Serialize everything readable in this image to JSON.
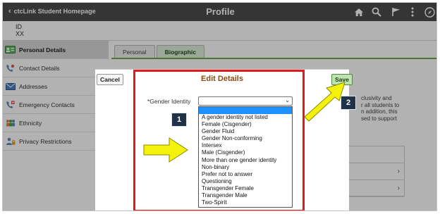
{
  "header": {
    "back_label": "ctcLink Student Homepage",
    "title": "Profile",
    "icons": [
      "home-icon",
      "search-icon",
      "flag-icon",
      "more-vertical-icon",
      "compass-icon"
    ]
  },
  "user": {
    "id_label": "ID",
    "id_value": "XX"
  },
  "sidebar": {
    "items": [
      {
        "label": "Personal Details",
        "icon": "id-card-icon",
        "active": true
      },
      {
        "label": "Contact Details",
        "icon": "phone-icon"
      },
      {
        "label": "Addresses",
        "icon": "envelope-icon"
      },
      {
        "label": "Emergency Contacts",
        "icon": "emergency-phone-icon"
      },
      {
        "label": "Ethnicity",
        "icon": "people-icon"
      },
      {
        "label": "Privacy Restrictions",
        "icon": "person-lock-icon"
      }
    ]
  },
  "tabs": [
    {
      "label": "Personal"
    },
    {
      "label": "Biographic",
      "selected": true
    }
  ],
  "background_text": [
    "clusivity and",
    "r all students to",
    "n addition, this",
    "sed to support"
  ],
  "modal": {
    "cancel_label": "Cancel",
    "title": "Edit Details",
    "save_label": "Save",
    "field_label": "*Gender Identity",
    "selected_value": "",
    "options": [
      "A gender identity not listed",
      "Female (Cisgender)",
      "Gender Fluid",
      "Gender Non-conforming",
      "Intersex",
      "Male (Cisgender)",
      "More than one gender identity",
      "Non-binary",
      "Prefer not to answer",
      "Questioning",
      "Transgender Female",
      "Transgender Male",
      "Two-Spirit"
    ]
  },
  "callouts": {
    "one": "1",
    "two": "2"
  },
  "colors": {
    "header_bg": "#4d4d4d",
    "modal_title": "#8a4b12",
    "highlight_red": "#e01b1b",
    "arrow_yellow": "#f4f20a",
    "badge_bg": "#1f3247",
    "save_green": "#bfe3b0"
  }
}
